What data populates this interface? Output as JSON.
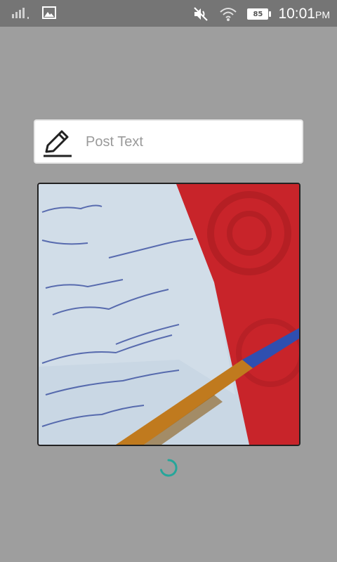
{
  "status_bar": {
    "battery_level": "85",
    "time": "10:01",
    "ampm": "PM",
    "icons": [
      "signal-icon",
      "gallery-icon",
      "mute-icon",
      "wifi-icon",
      "battery-icon"
    ]
  },
  "post": {
    "placeholder": "Post Text",
    "value": "",
    "icon": "pencil-icon"
  },
  "photo": {
    "label": "selected-photo"
  },
  "colors": {
    "background": "#9e9e9e",
    "status_bar": "#757575",
    "spinner": "#26a69a",
    "paper": "#c9d7e4",
    "fabric": "#c8242a"
  }
}
